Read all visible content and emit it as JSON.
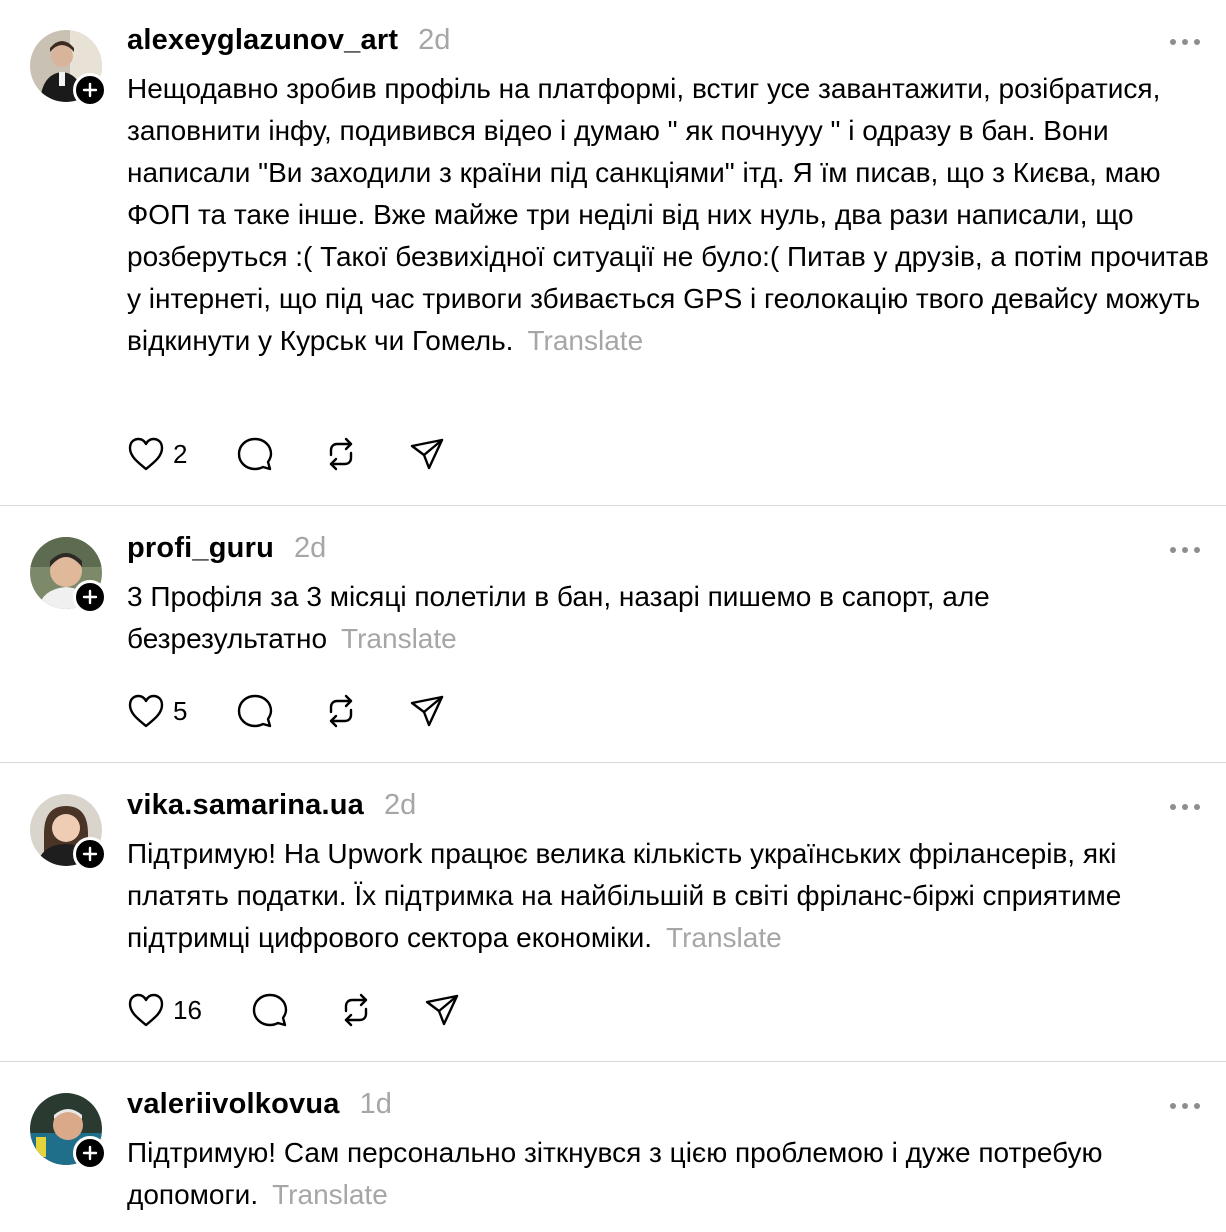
{
  "posts": [
    {
      "username": "alexeyglazunov_art",
      "time": "2d",
      "text": "Нещодавно зробив профіль на платформі, встиг усе завантажити, розібратися, заповнити інфу, подивився відео і думаю \" як почнууу \" і одразу в бан. Вони написали \"Ви заходили з країни під санкціями\" ітд. Я їм писав, що з Києва, маю ФОП та таке інше. Вже майже три неділі від них нуль, два рази написали, що розберуться :( Такої безвихідної ситуації не було:( Питав у друзів, а потім прочитав у інтернеті, що під час тривоги збивається GPS і геолокацію твого девайсу можуть відкинути у Курськ чи Гомель.",
      "translate": "Translate",
      "likes": "2"
    },
    {
      "username": "profi_guru",
      "time": "2d",
      "text": "3 Профіля за 3 місяці полетіли в бан, назарі пишемо в сапорт, але безрезультатно",
      "translate": "Translate",
      "likes": "5"
    },
    {
      "username": "vika.samarina.ua",
      "time": "2d",
      "text": "Підтримую! На Upwork працює велика кількість українських фрілансерів, які платять податки. Їх підтримка на найбільшій в світі фріланс-біржі сприятиме підтримці цифрового сектора економіки.",
      "translate": "Translate",
      "likes": "16"
    },
    {
      "username": "valeriivolkovua",
      "time": "1d",
      "text": "Підтримую! Сам персонально зіткнувся з цією проблемою і дуже потребую допомоги.",
      "translate": "Translate"
    }
  ],
  "icons": {
    "like": "heart-icon",
    "reply": "comment-icon",
    "repost": "repost-icon",
    "share": "send-icon",
    "more": "more-icon",
    "follow": "plus-icon"
  },
  "colors": {
    "text": "#000000",
    "muted": "#a6a6a6",
    "divider": "#d9d9d9"
  }
}
